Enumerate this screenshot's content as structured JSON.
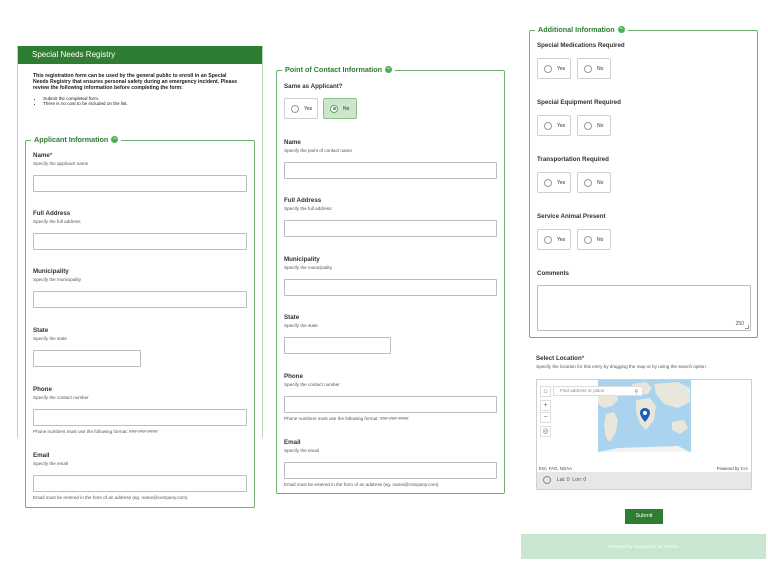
{
  "registry": {
    "header": "Special Needs Registry",
    "intro": "This registration form can be used by the general public to enroll in an Special Needs Registry that ensures personal safety during an emergency incident. Please review the following information before completing the form:",
    "bullets": [
      "Submit the completed form.",
      "There is no cost to be included on the list."
    ]
  },
  "applicant": {
    "title": "Applicant Information",
    "name": {
      "label": "Name",
      "required": "*",
      "hint": "Specify the applicant name"
    },
    "address": {
      "label": "Full Address",
      "hint": "Specify the full address"
    },
    "municipality": {
      "label": "Municipality",
      "hint": "Specify the municipality"
    },
    "state": {
      "label": "State",
      "hint": "Specify the state"
    },
    "phone": {
      "label": "Phone",
      "hint": "Specify the contact number",
      "note": "Phone numbers must use the following format: ###-###-####"
    },
    "email": {
      "label": "Email",
      "hint": "Specify the email",
      "note": "Email must be entered in the form of an address (eg. name@company.com)"
    }
  },
  "contact": {
    "title": "Point of Contact Information",
    "same": {
      "label": "Same as Applicant?",
      "yes": "Yes",
      "no": "No",
      "selected": "No"
    },
    "name": {
      "label": "Name",
      "hint": "Specify the point of contact name"
    },
    "address": {
      "label": "Full Address",
      "hint": "Specify the full address"
    },
    "municipality": {
      "label": "Municipality",
      "hint": "Specify the municipality"
    },
    "state": {
      "label": "State",
      "hint": "Specify the state"
    },
    "phone": {
      "label": "Phone",
      "hint": "Specify the contact number",
      "note": "Phone numbers must use the following format: ###-###-####"
    },
    "email": {
      "label": "Email",
      "hint": "Specify the email",
      "note": "Email must be entered in the form of an address (eg. name@company.com)"
    }
  },
  "additional": {
    "title": "Additional Information",
    "q1": {
      "label": "Special Medications Required",
      "yes": "Yes",
      "no": "No"
    },
    "q2": {
      "label": "Special Equipment Required",
      "yes": "Yes",
      "no": "No"
    },
    "q3": {
      "label": "Transportation Required",
      "yes": "Yes",
      "no": "No"
    },
    "q4": {
      "label": "Service Animal Present",
      "yes": "Yes",
      "no": "No"
    },
    "comments": {
      "label": "Comments",
      "counter": "250"
    }
  },
  "location": {
    "label": "Select Location",
    "required": "*",
    "hint": "Specify the location for this entry by dragging the map or by using the search option",
    "search_placeholder": "Find address or place",
    "attribution": "Esri, FAO, NOAA",
    "powered_prefix": "Powered by ",
    "powered_brand": "Esri",
    "lat": "Lat: 0",
    "lon": "Lon: 0"
  },
  "submit_label": "Submit",
  "footer": "Powered by Survey123 for ArcGIS",
  "colors": {
    "accent": "#2e7d32",
    "group_border": "#6fae6c",
    "selected_bg": "#cde5cb"
  }
}
